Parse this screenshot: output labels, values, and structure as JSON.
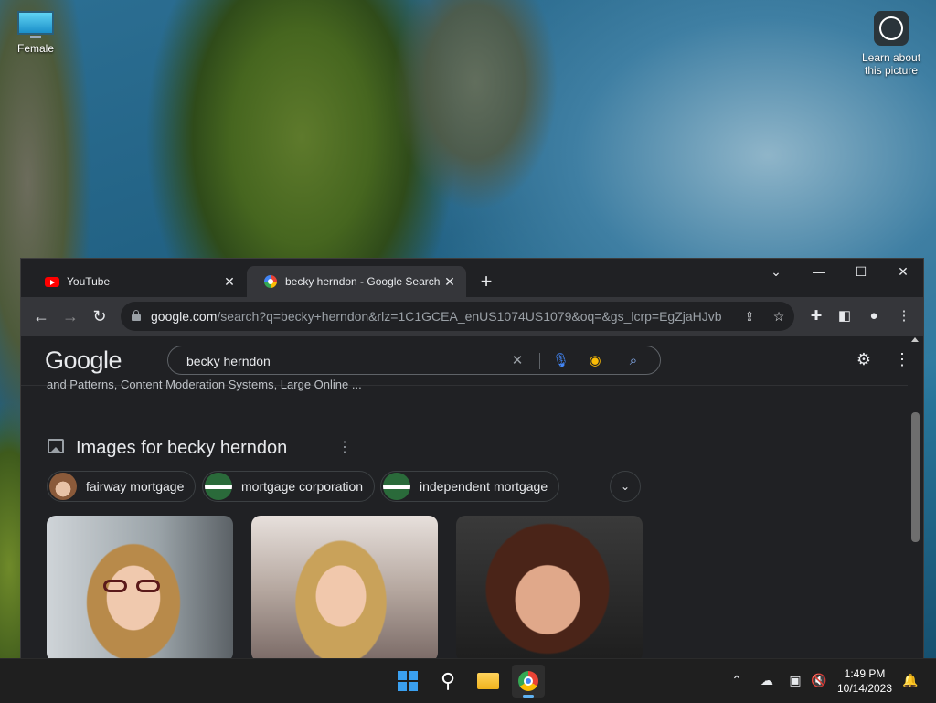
{
  "desktop": {
    "icons": [
      {
        "label": "Female"
      },
      {
        "label": "Learn about this picture"
      }
    ]
  },
  "browser": {
    "tabs": [
      {
        "label": "YouTube",
        "icon": "youtube-icon"
      },
      {
        "label": "becky herndon - Google Search",
        "icon": "google-icon",
        "active": true
      }
    ],
    "new_tab_label": "+",
    "address_bar": {
      "host": "google.com",
      "path": "/search?q=becky+herndon&rlz=1C1GCEA_enUS1074US1079&oq=&gs_lcrp=EgZjaHJvb..."
    }
  },
  "google": {
    "logo": "Google",
    "search_query": "becky herndon",
    "snippet": "and Patterns, Content Moderation Systems, Large Online ...",
    "images_title": "Images for becky herndon",
    "chips": [
      {
        "label": "fairway mortgage"
      },
      {
        "label": "mortgage corporation"
      },
      {
        "label": "independent mortgage"
      }
    ]
  },
  "taskbar": {
    "apps": [
      "start-button",
      "search-button",
      "file-explorer",
      "chrome"
    ],
    "time": "1:49 PM",
    "date": "10/14/2023"
  },
  "colors": {
    "accent": "#8ab4f8",
    "tab_active_bg": "#35363a",
    "page_bg": "#202124"
  }
}
